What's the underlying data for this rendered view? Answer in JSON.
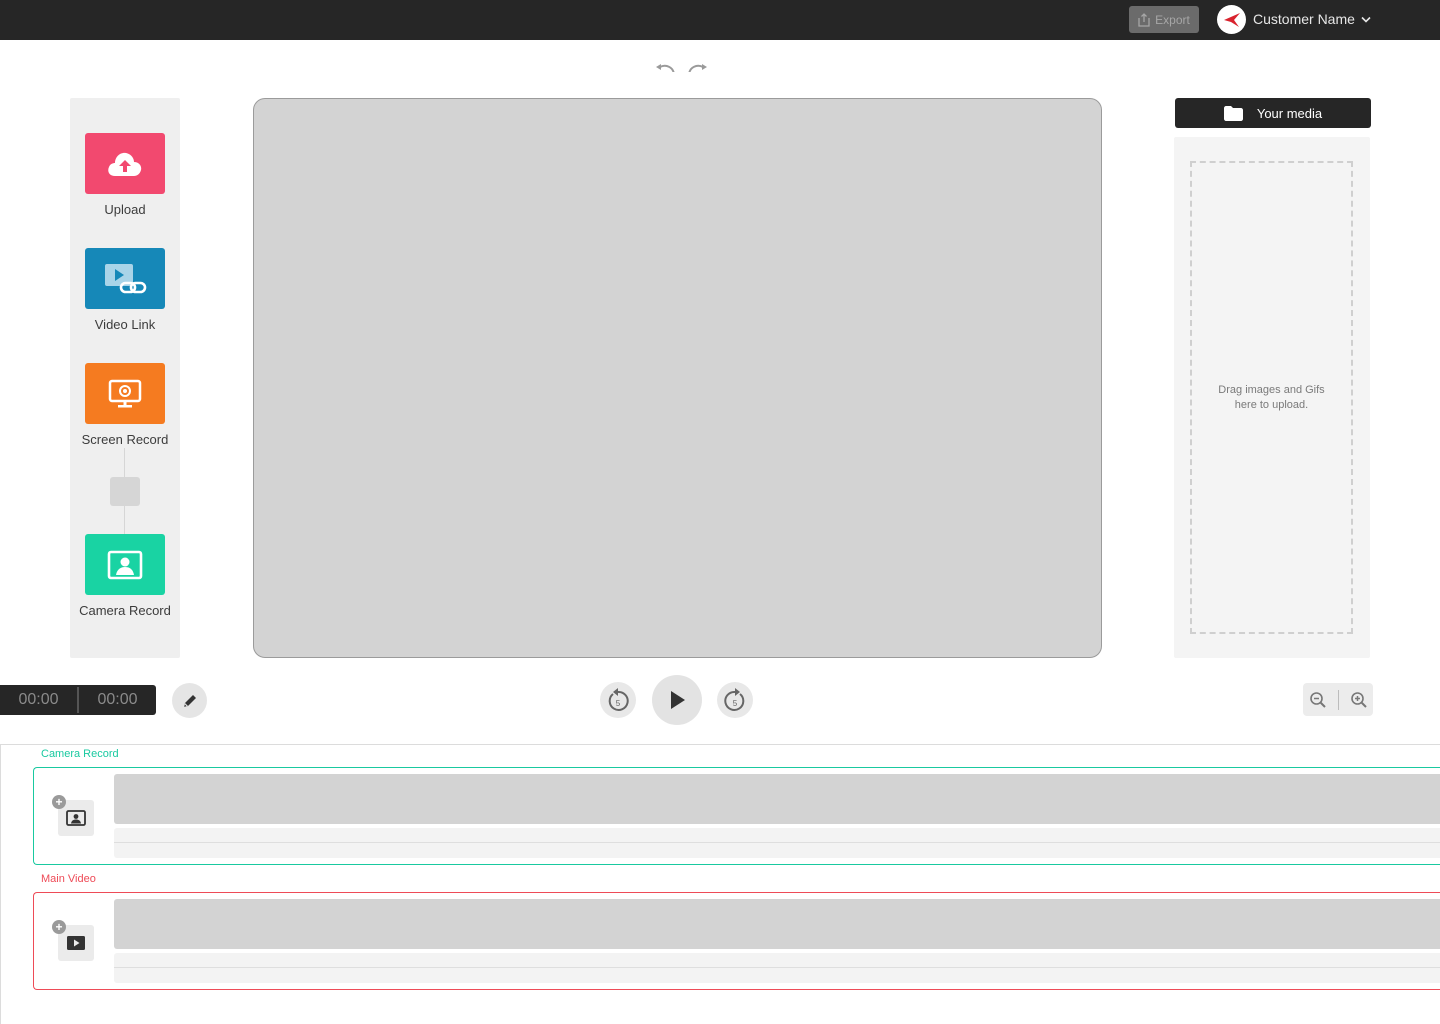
{
  "topbar": {
    "export_label": "Export",
    "customer_name": "Customer Name",
    "icons": [
      "export-icon",
      "brand-logo",
      "chevron-down-icon"
    ]
  },
  "toolbar": {
    "undo_icon": "undo-icon",
    "redo_icon": "redo-icon"
  },
  "tools": [
    {
      "label": "Upload",
      "color": "#f2496f",
      "icon": "cloud-upload-icon"
    },
    {
      "label": "Video Link",
      "color": "#1688b8",
      "icon": "video-link-icon"
    },
    {
      "label": "Screen Record",
      "color": "#f57b20",
      "icon": "screen-record-icon"
    },
    {
      "label": "Camera Record",
      "color": "#19d3a3",
      "icon": "camera-record-icon"
    }
  ],
  "media": {
    "button_label": "Your media",
    "button_icon": "folder-icon",
    "dropzone_text": "Drag images and Gifs here to upload."
  },
  "controls": {
    "current_time": "00:00",
    "total_time": "00:00",
    "rewind_seconds": "5",
    "forward_seconds": "5",
    "icons": [
      "edit-icon",
      "rewind-icon",
      "play-icon",
      "forward-icon",
      "zoom-out-icon",
      "zoom-in-icon"
    ]
  },
  "timeline": {
    "tracks": [
      {
        "label": "Camera Record",
        "color": "#19c9a0",
        "icon": "camera-record-icon"
      },
      {
        "label": "Main Video",
        "color": "#ee4b57",
        "icon": "video-play-icon"
      }
    ]
  }
}
